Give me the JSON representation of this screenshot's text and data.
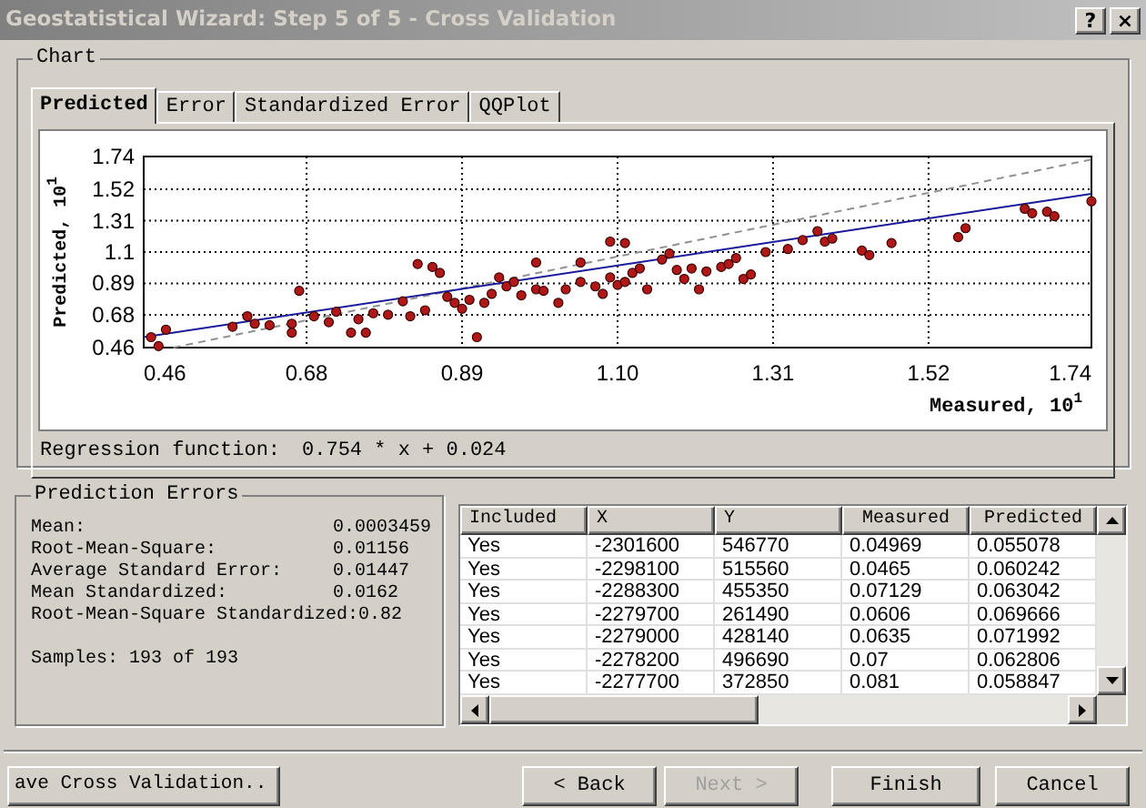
{
  "window": {
    "title": "Geostatistical Wizard: Step 5 of 5 - Cross Validation",
    "buttons": [
      "?",
      "×"
    ]
  },
  "chart_group": {
    "title": "Chart",
    "tabs": [
      {
        "label": "Predicted",
        "selected": true
      },
      {
        "label": "Error",
        "selected": false
      },
      {
        "label": "Standardized Error",
        "selected": false
      },
      {
        "label": "QQPlot",
        "selected": false
      }
    ],
    "chart_data": {
      "type": "scatter",
      "xlabel": "Measured, 10$^{1}$",
      "ylabel": "Predicted, 10$^{1}$",
      "xlim": [
        0.46,
        1.74
      ],
      "ylim": [
        0.46,
        1.74
      ],
      "xticks": [
        {
          "value": 0.46,
          "label": "0.46"
        },
        {
          "value": 0.68,
          "label": "0.68"
        },
        {
          "value": 0.89,
          "label": "0.89"
        },
        {
          "value": 1.1,
          "label": "1.10"
        },
        {
          "value": 1.31,
          "label": "1.31"
        },
        {
          "value": 1.52,
          "label": "1.52"
        },
        {
          "value": 1.74,
          "label": "1.74"
        }
      ],
      "yticks": [
        {
          "value": 0.46,
          "label": "0.46"
        },
        {
          "value": 0.68,
          "label": "0.68"
        },
        {
          "value": 0.89,
          "label": "0.89"
        },
        {
          "value": 1.1,
          "label": "1.1"
        },
        {
          "value": 1.31,
          "label": "1.31"
        },
        {
          "value": 1.52,
          "label": "1.52"
        },
        {
          "value": 1.74,
          "label": "1.74"
        }
      ],
      "x": [
        0.47,
        0.49,
        0.48,
        0.58,
        0.6,
        0.61,
        0.63,
        0.66,
        0.67,
        0.66,
        0.69,
        0.71,
        0.72,
        0.74,
        0.76,
        0.75,
        0.77,
        0.79,
        0.81,
        0.82,
        0.83,
        0.85,
        0.86,
        0.84,
        0.87,
        0.88,
        0.89,
        0.9,
        0.91,
        0.92,
        0.93,
        0.95,
        0.96,
        0.97,
        0.99,
        1.0,
        1.02,
        1.03,
        1.05,
        1.07,
        1.08,
        1.09,
        1.1,
        1.11,
        1.12,
        1.13,
        1.14,
        1.16,
        1.18,
        1.19,
        1.2,
        1.22,
        1.24,
        1.25,
        1.27,
        1.28,
        1.3,
        1.26,
        1.33,
        1.35,
        1.37,
        1.38,
        1.39,
        1.43,
        1.44,
        1.47,
        1.56,
        1.57,
        1.65,
        1.66,
        1.68,
        1.69,
        1.74,
        1.17,
        1.09,
        1.11,
        0.99,
        1.21,
        1.05,
        0.94
      ],
      "series": [
        {
          "color": "#b01818",
          "values": [
            0.53,
            0.58,
            0.47,
            0.6,
            0.67,
            0.62,
            0.61,
            0.62,
            0.84,
            0.56,
            0.67,
            0.63,
            0.7,
            0.56,
            0.56,
            0.65,
            0.69,
            0.68,
            0.77,
            0.67,
            1.02,
            1.0,
            0.96,
            0.71,
            0.8,
            0.76,
            0.72,
            0.78,
            0.53,
            0.76,
            0.82,
            0.87,
            0.9,
            0.81,
            0.85,
            0.84,
            0.76,
            0.85,
            0.9,
            0.87,
            0.82,
            0.93,
            0.88,
            0.9,
            0.96,
            0.99,
            0.85,
            1.05,
            0.98,
            0.92,
            0.99,
            0.97,
            1.0,
            1.02,
            0.92,
            0.95,
            1.1,
            1.06,
            1.12,
            1.18,
            1.24,
            1.17,
            1.19,
            1.11,
            1.08,
            1.16,
            1.2,
            1.26,
            1.39,
            1.36,
            1.37,
            1.34,
            1.44,
            1.09,
            1.17,
            1.16,
            1.03,
            0.85,
            1.03,
            0.93
          ]
        },
        {
          "type": "line",
          "color": "#909090",
          "line_style": "dashed",
          "x": [
            0.5,
            1.74
          ],
          "values": [
            0.46,
            1.72
          ]
        },
        {
          "type": "line",
          "color": "#1a1a9a",
          "line_style": "solid",
          "x": [
            0.46,
            1.74
          ],
          "values": [
            0.53,
            1.49
          ]
        }
      ],
      "grid": true
    },
    "regression": {
      "label": "Regression function:",
      "value": "0.754 * x + 0.024"
    }
  },
  "prediction_errors": {
    "title": "Prediction Errors",
    "rows": [
      {
        "label": "Mean:",
        "value": "0.0003459"
      },
      {
        "label": "Root-Mean-Square:",
        "value": "0.01156"
      },
      {
        "label": "Average Standard Error:",
        "value": "0.01447"
      },
      {
        "label": "Mean Standardized:",
        "value": "0.0162"
      },
      {
        "label": "Root-Mean-Square Standardized:",
        "value": "0.82"
      }
    ],
    "samples": "Samples: 193 of 193"
  },
  "table": {
    "columns": [
      "Included",
      "X",
      "Y",
      "Measured",
      "Predicted"
    ],
    "rows": [
      [
        "Yes",
        "-2301600",
        "546770",
        "0.04969",
        "0.055078"
      ],
      [
        "Yes",
        "-2298100",
        "515560",
        "0.0465",
        "0.060242"
      ],
      [
        "Yes",
        "-2288300",
        "455350",
        "0.07129",
        "0.063042"
      ],
      [
        "Yes",
        "-2279700",
        "261490",
        "0.0606",
        "0.069666"
      ],
      [
        "Yes",
        "-2279000",
        "428140",
        "0.0635",
        "0.071992"
      ],
      [
        "Yes",
        "-2278200",
        "496690",
        "0.07",
        "0.062806"
      ],
      [
        "Yes",
        "-2277700",
        "372850",
        "0.081",
        "0.058847"
      ]
    ]
  },
  "footer": {
    "save_button": "ave Cross Validation..",
    "buttons": [
      {
        "label": "< Back",
        "disabled": false
      },
      {
        "label": "Next >",
        "disabled": true
      },
      {
        "label": "Finish",
        "disabled": false
      },
      {
        "label": "Cancel",
        "disabled": false
      }
    ]
  }
}
